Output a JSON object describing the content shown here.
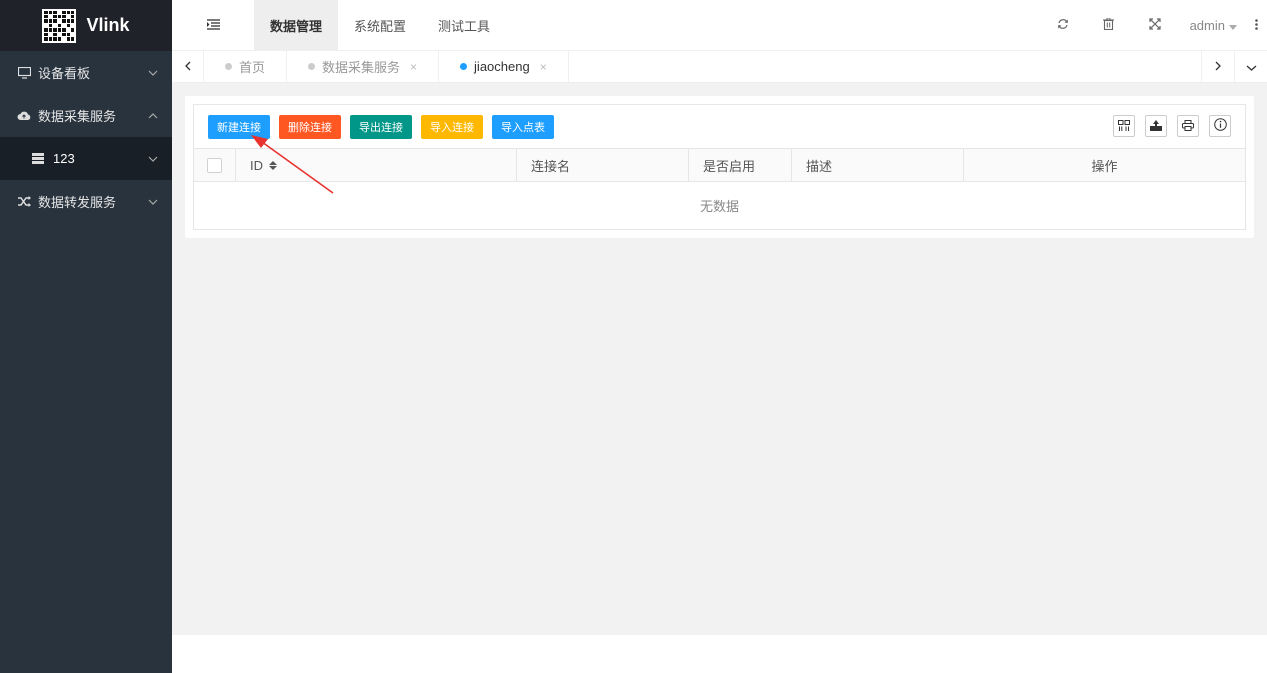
{
  "app": {
    "name": "Vlink"
  },
  "sidebar": {
    "items": [
      {
        "label": "设备看板",
        "icon": "monitor-icon",
        "expanded": false
      },
      {
        "label": "数据采集服务",
        "icon": "cloud-icon",
        "expanded": true
      },
      {
        "label": "123",
        "icon": "server-icon",
        "sub": true
      },
      {
        "label": "数据转发服务",
        "icon": "shuffle-icon",
        "expanded": false
      }
    ]
  },
  "header": {
    "menus": [
      "数据管理",
      "系统配置",
      "测试工具"
    ],
    "active_menu": "数据管理",
    "user": "admin"
  },
  "tabs": {
    "items": [
      {
        "label": "首页",
        "closable": false,
        "active": false
      },
      {
        "label": "数据采集服务",
        "closable": true,
        "active": false
      },
      {
        "label": "jiaocheng",
        "closable": true,
        "active": true
      }
    ],
    "close_glyph": "×"
  },
  "toolbar": {
    "buttons": [
      {
        "label": "新建连接",
        "color": "#1e9fff"
      },
      {
        "label": "删除连接",
        "color": "#ff5722"
      },
      {
        "label": "导出连接",
        "color": "#009688"
      },
      {
        "label": "导入连接",
        "color": "#ffb800"
      },
      {
        "label": "导入点表",
        "color": "#1e9fff"
      }
    ]
  },
  "table": {
    "columns": [
      "ID",
      "连接名",
      "是否启用",
      "描述",
      "操作"
    ],
    "empty_text": "无数据"
  },
  "colors": {
    "sidebar": "#28333e",
    "logo_bg": "#20222a",
    "accent": "#1e9fff",
    "annotation_arrow": "#e8322f"
  }
}
